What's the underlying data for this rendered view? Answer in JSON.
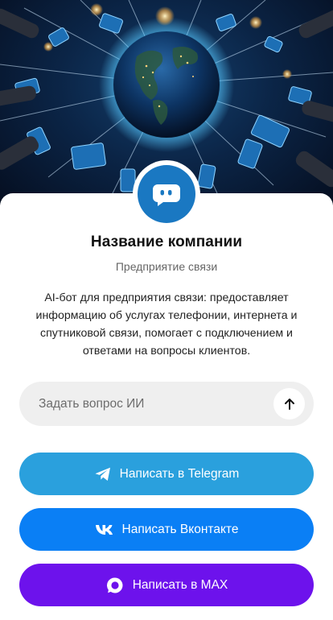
{
  "company": {
    "name": "Название компании",
    "category": "Предприятие связи",
    "description": "AI-бот для предприятия связи: предоставляет информацию об услугах телефонии, интернета и спутниковой связи, помогает с подключением и ответами на вопросы клиентов."
  },
  "ask": {
    "placeholder": "Задать вопрос ИИ",
    "send_icon": "arrow-up-icon"
  },
  "buttons": {
    "telegram": {
      "label": "Написать в Telegram",
      "icon": "telegram-icon",
      "color": "#2aa0dd"
    },
    "vk": {
      "label": "Написать Вконтакте",
      "icon": "vk-icon",
      "color": "#0a7ff5"
    },
    "max": {
      "label": "Написать в MAX",
      "icon": "max-icon",
      "color": "#6d12ec"
    }
  },
  "colors": {
    "avatar": "#1a78c2",
    "hero_background": "#0b2547"
  },
  "hero": {
    "image": "globe surrounded by hands holding phones and tablets"
  },
  "avatar": {
    "icon": "chat-bot-icon"
  }
}
